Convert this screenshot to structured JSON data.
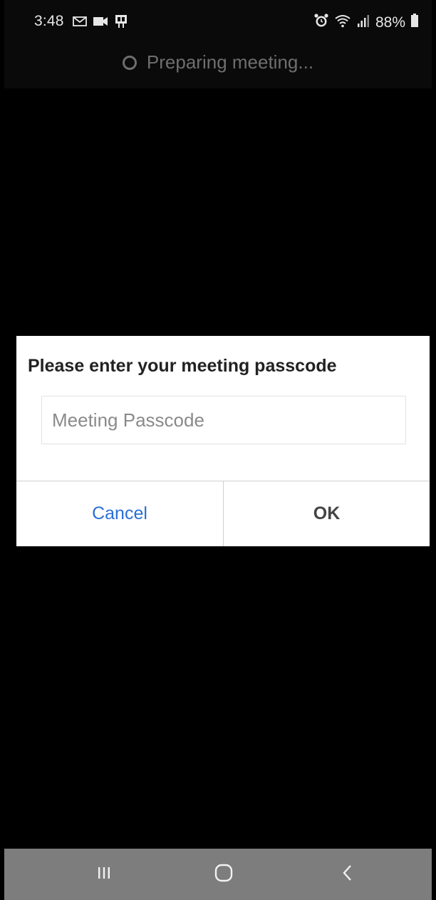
{
  "status_bar": {
    "time": "3:48",
    "battery": "88%",
    "left_icons": [
      "gmail-icon",
      "video-camera-icon",
      "notification-app-icon"
    ],
    "right_icons": [
      "alarm-icon",
      "wifi-icon",
      "signal-icon",
      "battery-icon"
    ]
  },
  "header": {
    "status_text": "Preparing meeting..."
  },
  "dialog": {
    "title": "Please enter your meeting passcode",
    "input": {
      "placeholder": "Meeting Passcode",
      "value": ""
    },
    "cancel_label": "Cancel",
    "ok_label": "OK"
  },
  "nav_bar": {
    "buttons": [
      "recents-icon",
      "home-icon",
      "back-icon"
    ]
  },
  "colors": {
    "background": "#000000",
    "dialog_bg": "#ffffff",
    "cancel_text": "#2a6fd6",
    "ok_text": "#444444",
    "nav_bar_bg": "#7d7d7d"
  }
}
